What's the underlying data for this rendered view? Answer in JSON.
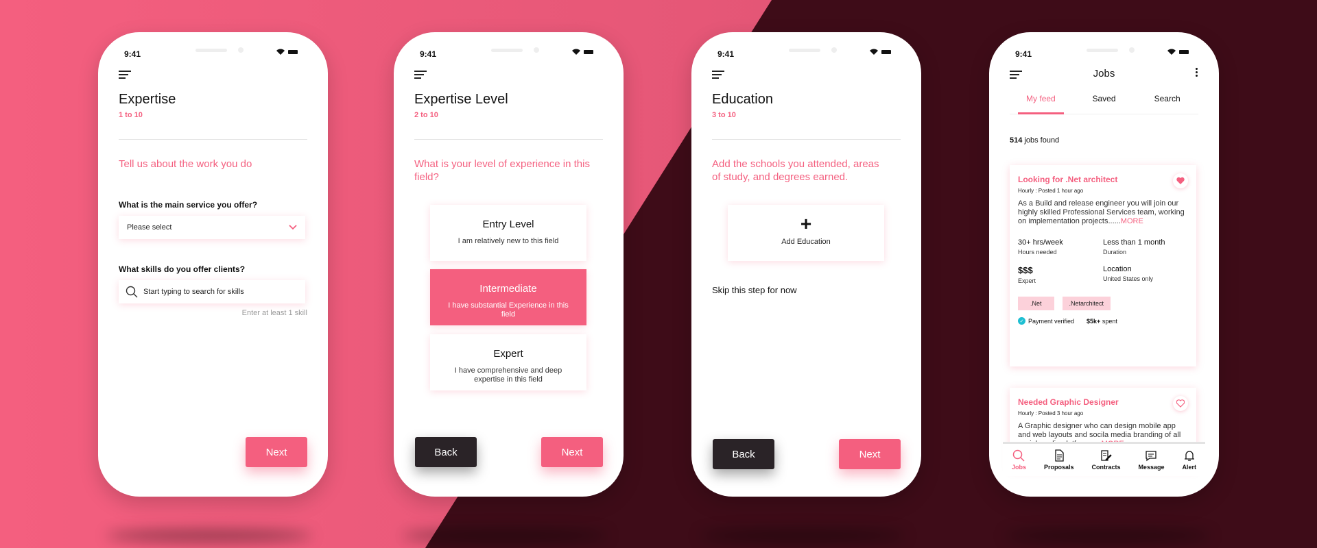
{
  "colors": {
    "accent": "#f45f7f",
    "dark": "#2a2327",
    "verified": "#1ebfd2"
  },
  "status_time": "9:41",
  "screen1": {
    "title": "Expertise",
    "subtitle": "1 to 10",
    "question": "Tell us about the work you do",
    "service_label": "What is the main service you offer?",
    "service_value": "Please select",
    "skills_label": "What skills do you offer clients?",
    "skills_placeholder": "Start typing to search for skills",
    "skills_hint": "Enter at least 1 skill",
    "next_label": "Next"
  },
  "screen2": {
    "title": "Expertise Level",
    "subtitle": "2 to 10",
    "question": "What is your level of experience in this field?",
    "levels": [
      {
        "title": "Entry Level",
        "desc": "I am relatively new to this field"
      },
      {
        "title": "Intermediate",
        "desc": "I have substantial Experience in this field"
      },
      {
        "title": "Expert",
        "desc": "I have comprehensive and deep expertise in this field"
      }
    ],
    "back_label": "Back",
    "next_label": "Next"
  },
  "screen3": {
    "title": "Education",
    "subtitle": "3 to 10",
    "question": "Add the schools you attended, areas of study, and degrees earned.",
    "add_label": "Add Education",
    "skip_label": "Skip this step for now",
    "back_label": "Back",
    "next_label": "Next"
  },
  "screen4": {
    "title": "Jobs",
    "tabs": [
      "My feed",
      "Saved",
      "Search"
    ],
    "found_count": "514",
    "found_text": " jobs found",
    "jobs": [
      {
        "title": "Looking for .Net architect",
        "meta": "Hourly : Posted 1 hour ago",
        "desc": "As a Build and release engineer you will join our highly skilled Professional Services team, working on implementation projects......",
        "more": "MORE",
        "hours": "30+ hrs/week",
        "hours_label": "Hours needed",
        "duration": "Less than 1 month",
        "duration_label": "Duration",
        "level": "$$$",
        "level_label": "Expert",
        "location": "Location",
        "location_label": "United States only",
        "tags": [
          ".Net",
          ".Netarchitect"
        ],
        "verified": "Payment verified",
        "spent_amount": "$5k+",
        "spent_text": " spent"
      },
      {
        "title": "Needed Graphic Designer",
        "meta": "Hourly : Posted 3 hour ago",
        "desc": "A Graphic designer who can design mobile app and web layouts and socila media branding of all social media platforms....",
        "more": "MORE"
      }
    ],
    "nav": [
      "Jobs",
      "Proposals",
      "Contracts",
      "Message",
      "Alert"
    ]
  }
}
